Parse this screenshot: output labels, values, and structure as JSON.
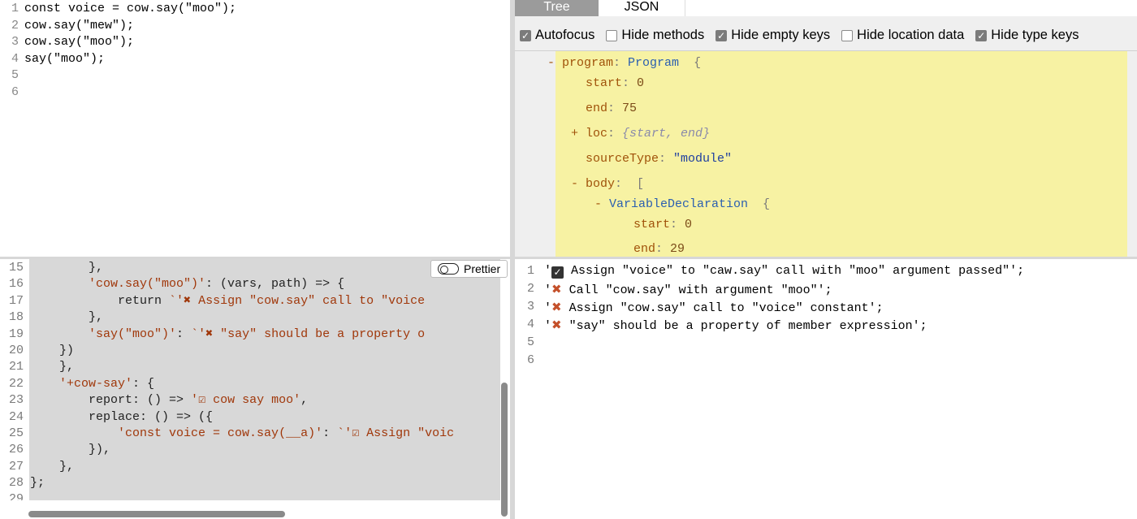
{
  "source_editor": {
    "lines": [
      {
        "n": "1",
        "text": "const voice = cow.say(\"moo\");"
      },
      {
        "n": "2",
        "text": "cow.say(\"mew\");"
      },
      {
        "n": "3",
        "text": "cow.say(\"moo\");"
      },
      {
        "n": "4",
        "text": "say(\"moo\");"
      },
      {
        "n": "5",
        "text": ""
      },
      {
        "n": "6",
        "text": ""
      }
    ]
  },
  "ast_panel": {
    "tabs": [
      "Tree",
      "JSON"
    ],
    "active_tab": "Tree",
    "options": [
      {
        "label": "Autofocus",
        "checked": true
      },
      {
        "label": "Hide methods",
        "checked": false
      },
      {
        "label": "Hide empty keys",
        "checked": true
      },
      {
        "label": "Hide location data",
        "checked": false
      },
      {
        "label": "Hide type keys",
        "checked": true
      }
    ],
    "tree": {
      "program_key": "program",
      "program_type": "Program",
      "start_key": "start",
      "start_val": "0",
      "end_key": "end",
      "end_val": "75",
      "loc_key": "loc",
      "loc_val": "{start, end}",
      "source_key": "sourceType",
      "source_val": "\"module\"",
      "body_key": "body",
      "decl_type": "VariableDeclaration",
      "decl_start_val": "0",
      "decl_end_val": "29"
    }
  },
  "plugin_editor": {
    "prettier_label": "Prettier",
    "lines": [
      {
        "n": "15",
        "text": "        },"
      },
      {
        "n": "16",
        "text": "        'cow.say(\"moo\")': (vars, path) => {"
      },
      {
        "n": "17",
        "text": "            return `'✖ Assign \"cow.say\" call to \"voice"
      },
      {
        "n": "18",
        "text": "        },"
      },
      {
        "n": "19",
        "text": "        'say(\"moo\")': `'✖ \"say\" should be a property o"
      },
      {
        "n": "20",
        "text": "    })"
      },
      {
        "n": "21",
        "text": "    },"
      },
      {
        "n": "22",
        "text": "    '+cow-say': {"
      },
      {
        "n": "23",
        "text": "        report: () => '☑ cow say moo',"
      },
      {
        "n": "24",
        "text": "        replace: () => ({"
      },
      {
        "n": "25",
        "text": "            'const voice = cow.say(__a)': `'☑ Assign \"voic"
      },
      {
        "n": "26",
        "text": "        }),"
      },
      {
        "n": "27",
        "text": "    },"
      },
      {
        "n": "28",
        "text": "};"
      },
      {
        "n": "29",
        "text": ""
      }
    ]
  },
  "output": {
    "lines": [
      {
        "n": "1",
        "icon": "ok",
        "text": "Assign \"voice\" to \"caw.say\" call with \"moo\" argument passed\"';"
      },
      {
        "n": "2",
        "icon": "no",
        "text": "Call \"cow.say\" with argument \"moo\"';"
      },
      {
        "n": "3",
        "icon": "no",
        "text": "Assign \"cow.say\" call to \"voice\" constant';"
      },
      {
        "n": "4",
        "icon": "no",
        "text": "\"say\" should be a property of member expression';"
      },
      {
        "n": "5",
        "icon": "",
        "text": ""
      },
      {
        "n": "6",
        "icon": "",
        "text": ""
      }
    ]
  },
  "colors": {
    "tree_highlight": "#f7f2a3",
    "tab_active": "#9b9b9b",
    "editor_bg": "#d8d8d8",
    "error_mark": "#c4502a"
  }
}
